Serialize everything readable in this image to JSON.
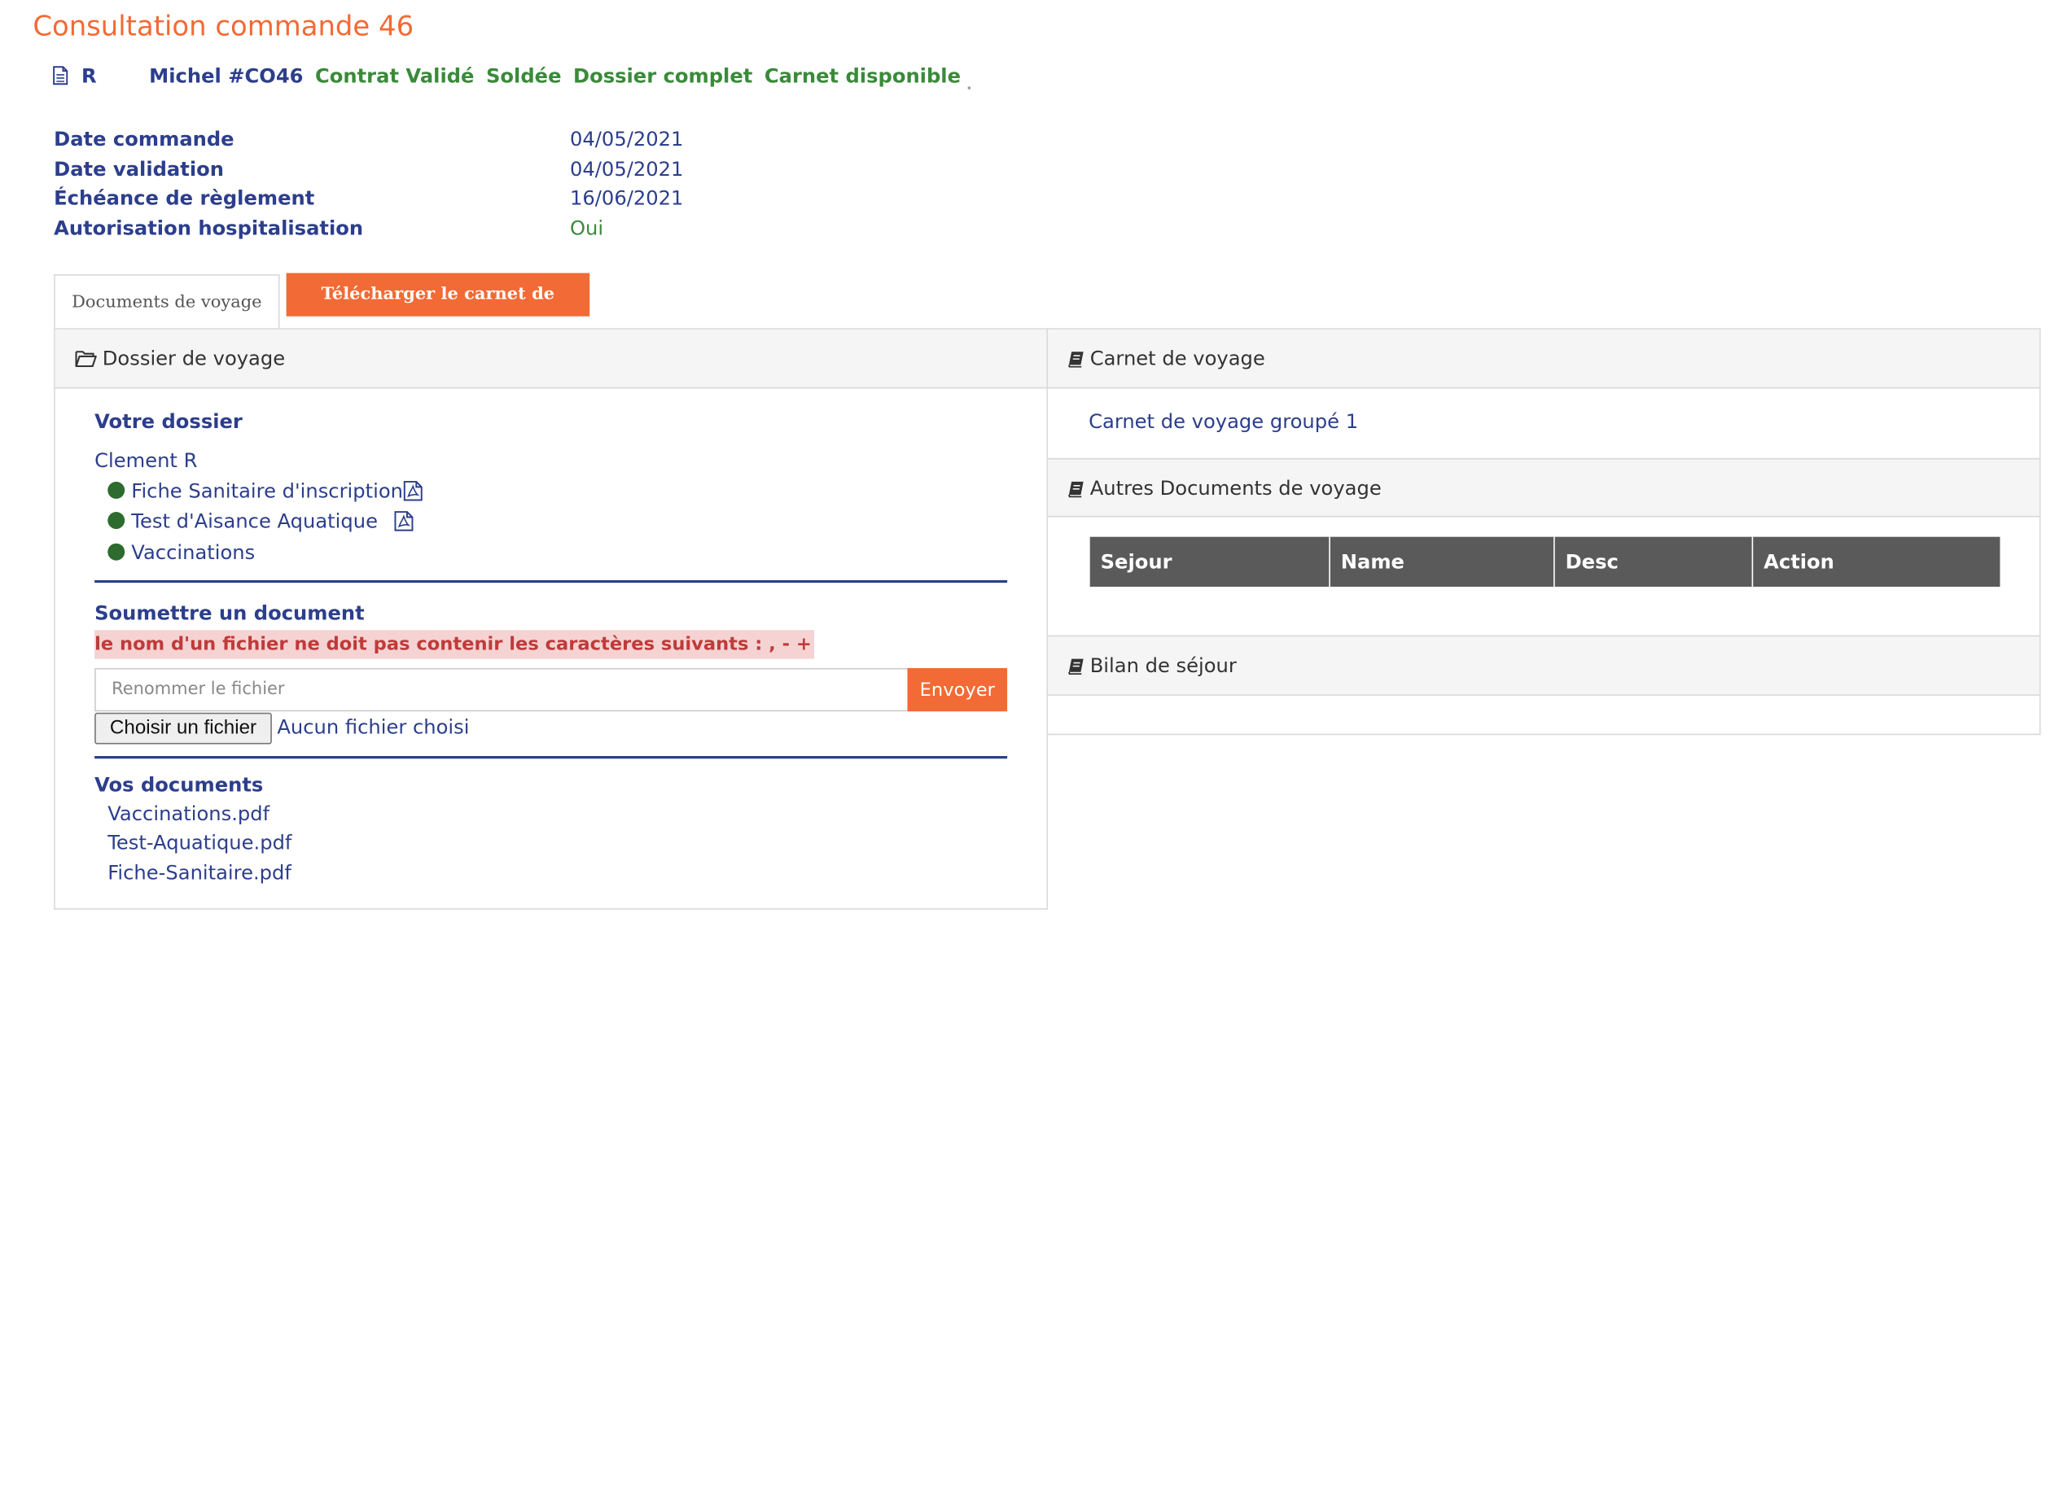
{
  "page": {
    "title": "Consultation commande 46"
  },
  "header": {
    "client_initial": "R",
    "client_ref": "Michel #CO46",
    "tags": [
      "Contrat Validé",
      "Soldée",
      "Dossier complet",
      "Carnet disponible"
    ]
  },
  "info": {
    "rows": [
      {
        "label": "Date commande",
        "value": "04/05/2021"
      },
      {
        "label": "Date validation",
        "value": "04/05/2021"
      },
      {
        "label": "Échéance de règlement",
        "value": "16/06/2021"
      },
      {
        "label": "Autorisation hospitalisation",
        "value": "Oui"
      }
    ]
  },
  "tabs": {
    "active": "Documents de voyage",
    "download_button": "Télécharger le carnet de voyage"
  },
  "dossier": {
    "header": "Dossier de voyage",
    "your_file_title": "Votre dossier",
    "client_name": "Clement R",
    "documents": [
      {
        "label": "Fiche Sanitaire d'inscription",
        "has_pdf": true
      },
      {
        "label": "Test d'Aisance Aquatique",
        "has_pdf": true
      },
      {
        "label": "Vaccinations",
        "has_pdf": false
      }
    ],
    "status_color": "#2e6b2e",
    "submit_title": "Soumettre un document",
    "warning": "le nom d'un fichier ne doit pas contenir les caractères suivants : , - +",
    "rename_placeholder": "Renommer le fichier",
    "send_button": "Envoyer",
    "choose_file_button": "Choisir un fichier",
    "no_file_text": "Aucun fichier choisi",
    "my_docs_title": "Vos documents",
    "my_docs": [
      "Vaccinations.pdf",
      "Test-Aquatique.pdf",
      "Fiche-Sanitaire.pdf"
    ]
  },
  "carnet": {
    "header": "Carnet de voyage",
    "link": "Carnet de voyage groupé 1"
  },
  "other_docs": {
    "header": "Autres Documents de voyage",
    "columns": [
      "Sejour",
      "Name",
      "Desc",
      "Action"
    ]
  },
  "bilan": {
    "header": "Bilan de séjour"
  },
  "colors": {
    "accent": "#f26a35",
    "primary_text": "#2c3e8c",
    "success": "#3a8a3a",
    "warning_bg": "#f5d3d3",
    "warning_text": "#c03a3a",
    "table_header": "#5a5a5a"
  }
}
